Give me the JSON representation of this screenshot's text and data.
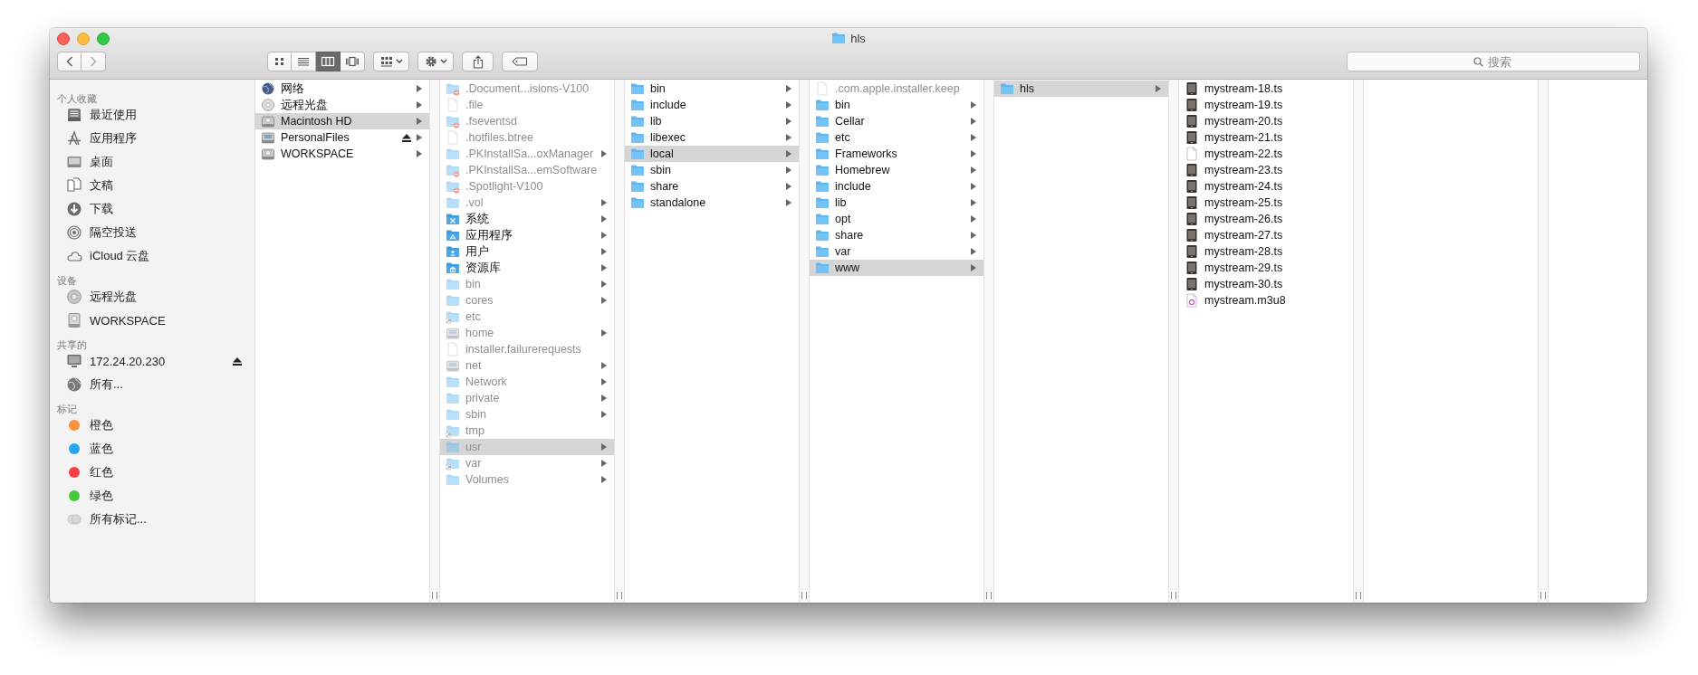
{
  "window": {
    "title": "hls"
  },
  "toolbar": {
    "view_modes": [
      {
        "kind": "icons",
        "selected": false
      },
      {
        "kind": "list",
        "selected": false
      },
      {
        "kind": "columns",
        "selected": true
      },
      {
        "kind": "coverflow",
        "selected": false
      }
    ],
    "search": {
      "placeholder": "搜索"
    }
  },
  "sidebar": {
    "sections": [
      {
        "heading": "个人收藏",
        "items": [
          {
            "label": "最近使用",
            "kind": "recents"
          },
          {
            "label": "应用程序",
            "kind": "applications"
          },
          {
            "label": "桌面",
            "kind": "desktop"
          },
          {
            "label": "文稿",
            "kind": "documents"
          },
          {
            "label": "下载",
            "kind": "downloads"
          },
          {
            "label": "隔空投送",
            "kind": "airdrop"
          },
          {
            "label": "iCloud 云盘",
            "kind": "cloud"
          }
        ]
      },
      {
        "heading": "设备",
        "items": [
          {
            "label": "远程光盘",
            "kind": "disc"
          },
          {
            "label": "WORKSPACE",
            "kind": "drive"
          }
        ]
      },
      {
        "heading": "共享的",
        "items": [
          {
            "label": "172.24.20.230",
            "kind": "monitor",
            "eject": true
          },
          {
            "label": "所有...",
            "kind": "globe",
            "eject": false
          }
        ]
      },
      {
        "heading": "标记",
        "items": [
          {
            "label": "橙色",
            "kind": "tag",
            "color": "#f7913a"
          },
          {
            "label": "蓝色",
            "kind": "tag",
            "color": "#27a4f0"
          },
          {
            "label": "红色",
            "kind": "tag",
            "color": "#f53e48"
          },
          {
            "label": "绿色",
            "kind": "tag",
            "color": "#46c93a"
          },
          {
            "label": "所有标记...",
            "kind": "all-tags"
          }
        ]
      }
    ]
  },
  "columns": [
    {
      "items": [
        {
          "name": "网络",
          "kind": "globe",
          "dimmed": false,
          "selected": false,
          "has_children": true,
          "eject": false
        },
        {
          "name": "远程光盘",
          "kind": "disc",
          "dimmed": false,
          "selected": false,
          "has_children": true,
          "eject": false
        },
        {
          "name": "Macintosh HD",
          "kind": "drive",
          "dimmed": false,
          "selected": true,
          "has_children": true,
          "eject": false
        },
        {
          "name": "PersonalFiles",
          "kind": "server",
          "dimmed": false,
          "selected": false,
          "has_children": true,
          "eject": true
        },
        {
          "name": "WORKSPACE",
          "kind": "drive",
          "dimmed": false,
          "selected": false,
          "has_children": true,
          "eject": false
        }
      ]
    },
    {
      "items": [
        {
          "name": ".Document...isions-V100",
          "kind": "restricted-folder",
          "dimmed": true,
          "selected": false,
          "has_children": false
        },
        {
          "name": ".file",
          "kind": "file",
          "dimmed": true,
          "selected": false,
          "has_children": false
        },
        {
          "name": ".fseventsd",
          "kind": "restricted-folder",
          "dimmed": true,
          "selected": false,
          "has_children": false
        },
        {
          "name": ".hotfiles.btree",
          "kind": "file",
          "dimmed": true,
          "selected": false,
          "has_children": false
        },
        {
          "name": ".PKInstallSa...oxManager",
          "kind": "folder",
          "dimmed": true,
          "selected": false,
          "has_children": true
        },
        {
          "name": ".PKInstallSa...emSoftware",
          "kind": "restricted-folder",
          "dimmed": true,
          "selected": false,
          "has_children": false
        },
        {
          "name": ".Spotlight-V100",
          "kind": "restricted-folder",
          "dimmed": true,
          "selected": false,
          "has_children": false
        },
        {
          "name": ".vol",
          "kind": "folder",
          "dimmed": true,
          "selected": false,
          "has_children": true
        },
        {
          "name": "系统",
          "kind": "system-folder",
          "dimmed": false,
          "selected": false,
          "has_children": true
        },
        {
          "name": "应用程序",
          "kind": "apps-folder",
          "dimmed": false,
          "selected": false,
          "has_children": true
        },
        {
          "name": "用户",
          "kind": "users-folder",
          "dimmed": false,
          "selected": false,
          "has_children": true
        },
        {
          "name": "资源库",
          "kind": "library-folder",
          "dimmed": false,
          "selected": false,
          "has_children": true
        },
        {
          "name": "bin",
          "kind": "folder",
          "dimmed": true,
          "selected": false,
          "has_children": true
        },
        {
          "name": "cores",
          "kind": "folder",
          "dimmed": true,
          "selected": false,
          "has_children": true
        },
        {
          "name": "etc",
          "kind": "alias-folder",
          "dimmed": true,
          "selected": false,
          "has_children": false
        },
        {
          "name": "home",
          "kind": "server",
          "dimmed": true,
          "selected": false,
          "has_children": true
        },
        {
          "name": "installer.failurerequests",
          "kind": "file",
          "dimmed": true,
          "selected": false,
          "has_children": false
        },
        {
          "name": "net",
          "kind": "server",
          "dimmed": true,
          "selected": false,
          "has_children": true
        },
        {
          "name": "Network",
          "kind": "folder",
          "dimmed": true,
          "selected": false,
          "has_children": true
        },
        {
          "name": "private",
          "kind": "folder",
          "dimmed": true,
          "selected": false,
          "has_children": true
        },
        {
          "name": "sbin",
          "kind": "folder",
          "dimmed": true,
          "selected": false,
          "has_children": true
        },
        {
          "name": "tmp",
          "kind": "alias-folder",
          "dimmed": true,
          "selected": false,
          "has_children": false
        },
        {
          "name": "usr",
          "kind": "folder",
          "dimmed": true,
          "selected": true,
          "has_children": true
        },
        {
          "name": "var",
          "kind": "alias-folder",
          "dimmed": true,
          "selected": false,
          "has_children": true
        },
        {
          "name": "Volumes",
          "kind": "folder",
          "dimmed": true,
          "selected": false,
          "has_children": true
        }
      ]
    },
    {
      "items": [
        {
          "name": "bin",
          "kind": "folder",
          "dimmed": false,
          "selected": false,
          "has_children": true
        },
        {
          "name": "include",
          "kind": "folder",
          "dimmed": false,
          "selected": false,
          "has_children": true
        },
        {
          "name": "lib",
          "kind": "folder",
          "dimmed": false,
          "selected": false,
          "has_children": true
        },
        {
          "name": "libexec",
          "kind": "folder",
          "dimmed": false,
          "selected": false,
          "has_children": true
        },
        {
          "name": "local",
          "kind": "folder",
          "dimmed": false,
          "selected": true,
          "has_children": true
        },
        {
          "name": "sbin",
          "kind": "folder",
          "dimmed": false,
          "selected": false,
          "has_children": true
        },
        {
          "name": "share",
          "kind": "folder",
          "dimmed": false,
          "selected": false,
          "has_children": true
        },
        {
          "name": "standalone",
          "kind": "folder",
          "dimmed": false,
          "selected": false,
          "has_children": true
        }
      ]
    },
    {
      "items": [
        {
          "name": ".com.apple.installer.keep",
          "kind": "file",
          "dimmed": true,
          "selected": false,
          "has_children": false
        },
        {
          "name": "bin",
          "kind": "folder",
          "dimmed": false,
          "selected": false,
          "has_children": true
        },
        {
          "name": "Cellar",
          "kind": "folder",
          "dimmed": false,
          "selected": false,
          "has_children": true
        },
        {
          "name": "etc",
          "kind": "folder",
          "dimmed": false,
          "selected": false,
          "has_children": true
        },
        {
          "name": "Frameworks",
          "kind": "folder",
          "dimmed": false,
          "selected": false,
          "has_children": true
        },
        {
          "name": "Homebrew",
          "kind": "folder",
          "dimmed": false,
          "selected": false,
          "has_children": true
        },
        {
          "name": "include",
          "kind": "folder",
          "dimmed": false,
          "selected": false,
          "has_children": true
        },
        {
          "name": "lib",
          "kind": "folder",
          "dimmed": false,
          "selected": false,
          "has_children": true
        },
        {
          "name": "opt",
          "kind": "folder",
          "dimmed": false,
          "selected": false,
          "has_children": true
        },
        {
          "name": "share",
          "kind": "folder",
          "dimmed": false,
          "selected": false,
          "has_children": true
        },
        {
          "name": "var",
          "kind": "folder",
          "dimmed": false,
          "selected": false,
          "has_children": true
        },
        {
          "name": "www",
          "kind": "folder",
          "dimmed": false,
          "selected": true,
          "has_children": true
        }
      ]
    },
    {
      "items": [
        {
          "name": "hls",
          "kind": "folder",
          "dimmed": false,
          "selected": true,
          "has_children": true
        }
      ]
    },
    {
      "items": [
        {
          "name": "mystream-18.ts",
          "kind": "video",
          "dimmed": false,
          "selected": false,
          "has_children": false
        },
        {
          "name": "mystream-19.ts",
          "kind": "video",
          "dimmed": false,
          "selected": false,
          "has_children": false
        },
        {
          "name": "mystream-20.ts",
          "kind": "video",
          "dimmed": false,
          "selected": false,
          "has_children": false
        },
        {
          "name": "mystream-21.ts",
          "kind": "video",
          "dimmed": false,
          "selected": false,
          "has_children": false
        },
        {
          "name": "mystream-22.ts",
          "kind": "file",
          "dimmed": false,
          "selected": false,
          "has_children": false
        },
        {
          "name": "mystream-23.ts",
          "kind": "video",
          "dimmed": false,
          "selected": false,
          "has_children": false
        },
        {
          "name": "mystream-24.ts",
          "kind": "video",
          "dimmed": false,
          "selected": false,
          "has_children": false
        },
        {
          "name": "mystream-25.ts",
          "kind": "video",
          "dimmed": false,
          "selected": false,
          "has_children": false
        },
        {
          "name": "mystream-26.ts",
          "kind": "video",
          "dimmed": false,
          "selected": false,
          "has_children": false
        },
        {
          "name": "mystream-27.ts",
          "kind": "video",
          "dimmed": false,
          "selected": false,
          "has_children": false
        },
        {
          "name": "mystream-28.ts",
          "kind": "video",
          "dimmed": false,
          "selected": false,
          "has_children": false
        },
        {
          "name": "mystream-29.ts",
          "kind": "video",
          "dimmed": false,
          "selected": false,
          "has_children": false
        },
        {
          "name": "mystream-30.ts",
          "kind": "video",
          "dimmed": false,
          "selected": false,
          "has_children": false
        },
        {
          "name": "mystream.m3u8",
          "kind": "playlist",
          "dimmed": false,
          "selected": false,
          "has_children": false
        }
      ]
    }
  ]
}
